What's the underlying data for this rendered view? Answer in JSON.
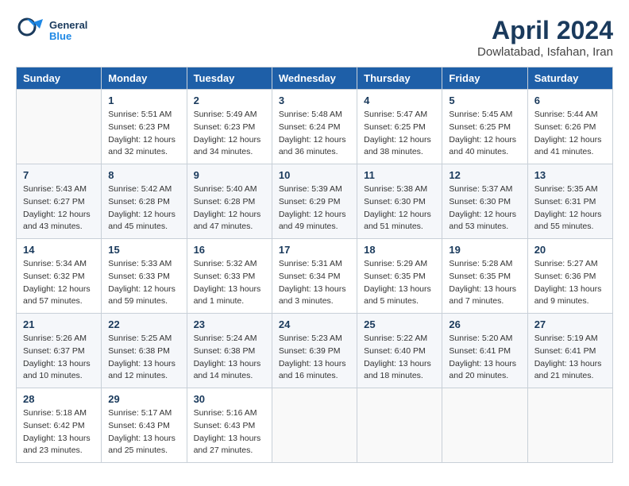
{
  "header": {
    "logo_general": "General",
    "logo_blue": "Blue",
    "month_year": "April 2024",
    "location": "Dowlatabad, Isfahan, Iran"
  },
  "calendar": {
    "days_of_week": [
      "Sunday",
      "Monday",
      "Tuesday",
      "Wednesday",
      "Thursday",
      "Friday",
      "Saturday"
    ],
    "weeks": [
      [
        {
          "day": "",
          "sunrise": "",
          "sunset": "",
          "daylight": ""
        },
        {
          "day": "1",
          "sunrise": "Sunrise: 5:51 AM",
          "sunset": "Sunset: 6:23 PM",
          "daylight": "Daylight: 12 hours and 32 minutes."
        },
        {
          "day": "2",
          "sunrise": "Sunrise: 5:49 AM",
          "sunset": "Sunset: 6:23 PM",
          "daylight": "Daylight: 12 hours and 34 minutes."
        },
        {
          "day": "3",
          "sunrise": "Sunrise: 5:48 AM",
          "sunset": "Sunset: 6:24 PM",
          "daylight": "Daylight: 12 hours and 36 minutes."
        },
        {
          "day": "4",
          "sunrise": "Sunrise: 5:47 AM",
          "sunset": "Sunset: 6:25 PM",
          "daylight": "Daylight: 12 hours and 38 minutes."
        },
        {
          "day": "5",
          "sunrise": "Sunrise: 5:45 AM",
          "sunset": "Sunset: 6:25 PM",
          "daylight": "Daylight: 12 hours and 40 minutes."
        },
        {
          "day": "6",
          "sunrise": "Sunrise: 5:44 AM",
          "sunset": "Sunset: 6:26 PM",
          "daylight": "Daylight: 12 hours and 41 minutes."
        }
      ],
      [
        {
          "day": "7",
          "sunrise": "Sunrise: 5:43 AM",
          "sunset": "Sunset: 6:27 PM",
          "daylight": "Daylight: 12 hours and 43 minutes."
        },
        {
          "day": "8",
          "sunrise": "Sunrise: 5:42 AM",
          "sunset": "Sunset: 6:28 PM",
          "daylight": "Daylight: 12 hours and 45 minutes."
        },
        {
          "day": "9",
          "sunrise": "Sunrise: 5:40 AM",
          "sunset": "Sunset: 6:28 PM",
          "daylight": "Daylight: 12 hours and 47 minutes."
        },
        {
          "day": "10",
          "sunrise": "Sunrise: 5:39 AM",
          "sunset": "Sunset: 6:29 PM",
          "daylight": "Daylight: 12 hours and 49 minutes."
        },
        {
          "day": "11",
          "sunrise": "Sunrise: 5:38 AM",
          "sunset": "Sunset: 6:30 PM",
          "daylight": "Daylight: 12 hours and 51 minutes."
        },
        {
          "day": "12",
          "sunrise": "Sunrise: 5:37 AM",
          "sunset": "Sunset: 6:30 PM",
          "daylight": "Daylight: 12 hours and 53 minutes."
        },
        {
          "day": "13",
          "sunrise": "Sunrise: 5:35 AM",
          "sunset": "Sunset: 6:31 PM",
          "daylight": "Daylight: 12 hours and 55 minutes."
        }
      ],
      [
        {
          "day": "14",
          "sunrise": "Sunrise: 5:34 AM",
          "sunset": "Sunset: 6:32 PM",
          "daylight": "Daylight: 12 hours and 57 minutes."
        },
        {
          "day": "15",
          "sunrise": "Sunrise: 5:33 AM",
          "sunset": "Sunset: 6:33 PM",
          "daylight": "Daylight: 12 hours and 59 minutes."
        },
        {
          "day": "16",
          "sunrise": "Sunrise: 5:32 AM",
          "sunset": "Sunset: 6:33 PM",
          "daylight": "Daylight: 13 hours and 1 minute."
        },
        {
          "day": "17",
          "sunrise": "Sunrise: 5:31 AM",
          "sunset": "Sunset: 6:34 PM",
          "daylight": "Daylight: 13 hours and 3 minutes."
        },
        {
          "day": "18",
          "sunrise": "Sunrise: 5:29 AM",
          "sunset": "Sunset: 6:35 PM",
          "daylight": "Daylight: 13 hours and 5 minutes."
        },
        {
          "day": "19",
          "sunrise": "Sunrise: 5:28 AM",
          "sunset": "Sunset: 6:35 PM",
          "daylight": "Daylight: 13 hours and 7 minutes."
        },
        {
          "day": "20",
          "sunrise": "Sunrise: 5:27 AM",
          "sunset": "Sunset: 6:36 PM",
          "daylight": "Daylight: 13 hours and 9 minutes."
        }
      ],
      [
        {
          "day": "21",
          "sunrise": "Sunrise: 5:26 AM",
          "sunset": "Sunset: 6:37 PM",
          "daylight": "Daylight: 13 hours and 10 minutes."
        },
        {
          "day": "22",
          "sunrise": "Sunrise: 5:25 AM",
          "sunset": "Sunset: 6:38 PM",
          "daylight": "Daylight: 13 hours and 12 minutes."
        },
        {
          "day": "23",
          "sunrise": "Sunrise: 5:24 AM",
          "sunset": "Sunset: 6:38 PM",
          "daylight": "Daylight: 13 hours and 14 minutes."
        },
        {
          "day": "24",
          "sunrise": "Sunrise: 5:23 AM",
          "sunset": "Sunset: 6:39 PM",
          "daylight": "Daylight: 13 hours and 16 minutes."
        },
        {
          "day": "25",
          "sunrise": "Sunrise: 5:22 AM",
          "sunset": "Sunset: 6:40 PM",
          "daylight": "Daylight: 13 hours and 18 minutes."
        },
        {
          "day": "26",
          "sunrise": "Sunrise: 5:20 AM",
          "sunset": "Sunset: 6:41 PM",
          "daylight": "Daylight: 13 hours and 20 minutes."
        },
        {
          "day": "27",
          "sunrise": "Sunrise: 5:19 AM",
          "sunset": "Sunset: 6:41 PM",
          "daylight": "Daylight: 13 hours and 21 minutes."
        }
      ],
      [
        {
          "day": "28",
          "sunrise": "Sunrise: 5:18 AM",
          "sunset": "Sunset: 6:42 PM",
          "daylight": "Daylight: 13 hours and 23 minutes."
        },
        {
          "day": "29",
          "sunrise": "Sunrise: 5:17 AM",
          "sunset": "Sunset: 6:43 PM",
          "daylight": "Daylight: 13 hours and 25 minutes."
        },
        {
          "day": "30",
          "sunrise": "Sunrise: 5:16 AM",
          "sunset": "Sunset: 6:43 PM",
          "daylight": "Daylight: 13 hours and 27 minutes."
        },
        {
          "day": "",
          "sunrise": "",
          "sunset": "",
          "daylight": ""
        },
        {
          "day": "",
          "sunrise": "",
          "sunset": "",
          "daylight": ""
        },
        {
          "day": "",
          "sunrise": "",
          "sunset": "",
          "daylight": ""
        },
        {
          "day": "",
          "sunrise": "",
          "sunset": "",
          "daylight": ""
        }
      ]
    ]
  }
}
